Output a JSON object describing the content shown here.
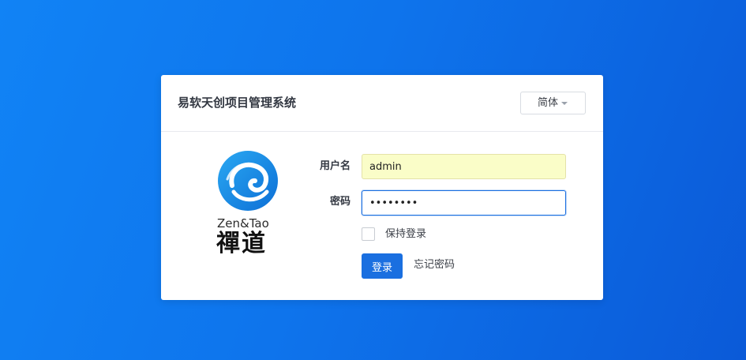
{
  "header": {
    "title": "易软天创项目管理系统",
    "language": "简体"
  },
  "logo": {
    "text_latin": "Zen&Tao",
    "text_chinese": "禪道",
    "icon": "zentao-swirl-logo"
  },
  "form": {
    "username_label": "用户名",
    "username_value": "admin",
    "password_label": "密码",
    "password_value": "12345678",
    "remember_label": "保持登录",
    "remember_checked": false,
    "login_button": "登录",
    "forgot_link": "忘记密码"
  },
  "colors": {
    "background_start": "#1183f5",
    "background_end": "#0b5ad8",
    "primary": "#1a6fe0",
    "autofill": "#fafdc8"
  }
}
